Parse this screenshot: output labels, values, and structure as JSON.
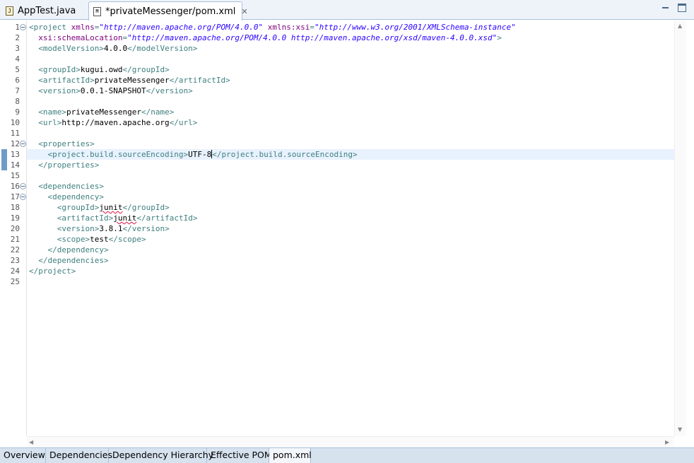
{
  "tabs": [
    {
      "label": "AppTest.java",
      "icon": "java-file-icon"
    },
    {
      "label": "*privateMessenger/pom.xml",
      "icon": "maven-file-icon",
      "active": true
    }
  ],
  "editor": {
    "lines": [
      {
        "n": "1",
        "seg": [
          [
            "t",
            "<project "
          ],
          [
            "a",
            "xmlns"
          ],
          [
            "t",
            "="
          ],
          [
            "v",
            "\"http://maven.apache.org/POM/4.0.0\""
          ],
          [
            "t",
            " "
          ],
          [
            "a",
            "xmlns:xsi"
          ],
          [
            "t",
            "="
          ],
          [
            "v",
            "\"http://www.w3.org/2001/XMLSchema-instance\""
          ]
        ]
      },
      {
        "n": "2",
        "seg": [
          [
            "t",
            "  "
          ],
          [
            "a",
            "xsi:schemaLocation"
          ],
          [
            "t",
            "="
          ],
          [
            "v",
            "\"http://maven.apache.org/POM/4.0.0 http://maven.apache.org/xsd/maven-4.0.0.xsd\""
          ],
          [
            "t",
            ">"
          ]
        ]
      },
      {
        "n": "3",
        "seg": [
          [
            "t",
            "  <modelVersion>"
          ],
          [
            "x",
            "4.0.0"
          ],
          [
            "t",
            "</modelVersion>"
          ]
        ]
      },
      {
        "n": "4",
        "seg": []
      },
      {
        "n": "5",
        "seg": [
          [
            "t",
            "  <groupId>"
          ],
          [
            "x",
            "kugui.owd"
          ],
          [
            "t",
            "</groupId>"
          ]
        ]
      },
      {
        "n": "6",
        "seg": [
          [
            "t",
            "  <artifactId>"
          ],
          [
            "x",
            "privateMessenger"
          ],
          [
            "t",
            "</artifactId>"
          ]
        ]
      },
      {
        "n": "7",
        "seg": [
          [
            "t",
            "  <version>"
          ],
          [
            "x",
            "0.0.1-SNAPSHOT"
          ],
          [
            "t",
            "</version>"
          ]
        ]
      },
      {
        "n": "8",
        "seg": []
      },
      {
        "n": "9",
        "seg": [
          [
            "t",
            "  <name>"
          ],
          [
            "x",
            "privateMessenger"
          ],
          [
            "t",
            "</name>"
          ]
        ]
      },
      {
        "n": "10",
        "seg": [
          [
            "t",
            "  <url>"
          ],
          [
            "x",
            "http://maven.apache.org"
          ],
          [
            "t",
            "</url>"
          ]
        ]
      },
      {
        "n": "11",
        "seg": []
      },
      {
        "n": "12",
        "seg": [
          [
            "t",
            "  <properties>"
          ]
        ]
      },
      {
        "n": "13",
        "seg": [
          [
            "t",
            "    <project.build.sourceEncoding>"
          ],
          [
            "x",
            "UTF-8"
          ],
          [
            "c",
            ""
          ],
          [
            "t",
            "</project.build.sourceEncoding>"
          ]
        ]
      },
      {
        "n": "14",
        "seg": [
          [
            "t",
            "  </properties>"
          ]
        ]
      },
      {
        "n": "15",
        "seg": []
      },
      {
        "n": "16",
        "seg": [
          [
            "t",
            "  <dependencies>"
          ]
        ]
      },
      {
        "n": "17",
        "seg": [
          [
            "t",
            "    <dependency>"
          ]
        ]
      },
      {
        "n": "18",
        "seg": [
          [
            "t",
            "      <groupId>"
          ],
          [
            "s",
            "junit"
          ],
          [
            "t",
            "</groupId>"
          ]
        ]
      },
      {
        "n": "19",
        "seg": [
          [
            "t",
            "      <artifactId>"
          ],
          [
            "s",
            "junit"
          ],
          [
            "t",
            "</artifactId>"
          ]
        ]
      },
      {
        "n": "20",
        "seg": [
          [
            "t",
            "      <version>"
          ],
          [
            "x",
            "3.8.1"
          ],
          [
            "t",
            "</version>"
          ]
        ]
      },
      {
        "n": "21",
        "seg": [
          [
            "t",
            "      <scope>"
          ],
          [
            "x",
            "test"
          ],
          [
            "t",
            "</scope>"
          ]
        ]
      },
      {
        "n": "22",
        "seg": [
          [
            "t",
            "    </dependency>"
          ]
        ]
      },
      {
        "n": "23",
        "seg": [
          [
            "t",
            "  </dependencies>"
          ]
        ]
      },
      {
        "n": "24",
        "seg": [
          [
            "t",
            "</project>"
          ]
        ]
      },
      {
        "n": "25",
        "seg": []
      }
    ],
    "fold_lines": [
      1,
      12,
      16,
      17
    ],
    "highlight_line": 13,
    "change_marks": [
      13,
      14
    ]
  },
  "page_tabs": [
    {
      "label": "Overview"
    },
    {
      "label": "Dependencies"
    },
    {
      "label": "Dependency Hierarchy"
    },
    {
      "label": "Effective POM"
    },
    {
      "label": "pom.xml",
      "active": true
    }
  ]
}
